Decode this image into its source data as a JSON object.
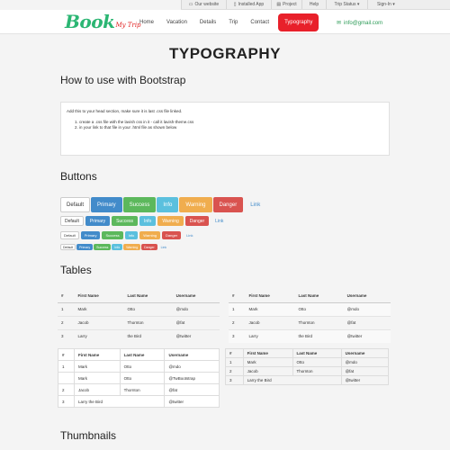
{
  "topbar": [
    {
      "icon": "monitor-icon",
      "label": "Our website"
    },
    {
      "icon": "phone-icon",
      "label": "Installed App"
    },
    {
      "icon": "document-icon",
      "label": "Project"
    },
    {
      "icon": "",
      "label": "Help"
    },
    {
      "icon": "",
      "label": "Trip Status ▾"
    },
    {
      "icon": "",
      "label": "Sign-In ▾"
    }
  ],
  "logo": {
    "main": "Book",
    "sub": "My Trip"
  },
  "nav": [
    "Home",
    "Vacation",
    "Details",
    "Trip",
    "Contact",
    "Typography"
  ],
  "email": "info@gmail.com",
  "page_title": "TYPOGRAPHY",
  "section1": {
    "title": "How to use with Bootstrap",
    "intro": "Add this to your head section, make sure it is last .css file linked.",
    "steps": [
      "create a .css file with the lavish css in it - call it lavish-theme.css",
      "in your link to that file in your .html file as shown below"
    ]
  },
  "buttons_title": "Buttons",
  "buttons": [
    "Default",
    "Primary",
    "Success",
    "Info",
    "Warning",
    "Danger",
    "Link"
  ],
  "tables_title": "Tables",
  "tables": {
    "headers": [
      "#",
      "First Name",
      "Last Name",
      "Username"
    ],
    "rows": [
      [
        "1",
        "Mark",
        "Otto",
        "@mdo"
      ],
      [
        "2",
        "Jacob",
        "Thornton",
        "@fat"
      ],
      [
        "3",
        "Larry",
        "the Bird",
        "@twitter"
      ]
    ],
    "bordered_rows": [
      [
        "1",
        "Mark",
        "Otto",
        "@mdo"
      ],
      [
        "",
        "Mark",
        "Otto",
        "@TwBootstrap"
      ],
      [
        "2",
        "Jacob",
        "Thornton",
        "@fat"
      ],
      [
        "3",
        "Larry the Bird",
        "",
        "@twitter"
      ]
    ],
    "condensed_rows": [
      [
        "1",
        "Mark",
        "Otto",
        "@mdo"
      ],
      [
        "2",
        "Jacob",
        "Thornton",
        "@fat"
      ],
      [
        "3",
        "Larry the Bird",
        "",
        "@twitter"
      ]
    ]
  },
  "thumbnails_title": "Thumbnails",
  "colors": {
    "brand_green": "#2bb673",
    "accent_red": "#e8202a",
    "primary": "#428bca",
    "success": "#5cb85c",
    "info": "#5bc0de",
    "warning": "#f0ad4e",
    "danger": "#d9534f"
  }
}
